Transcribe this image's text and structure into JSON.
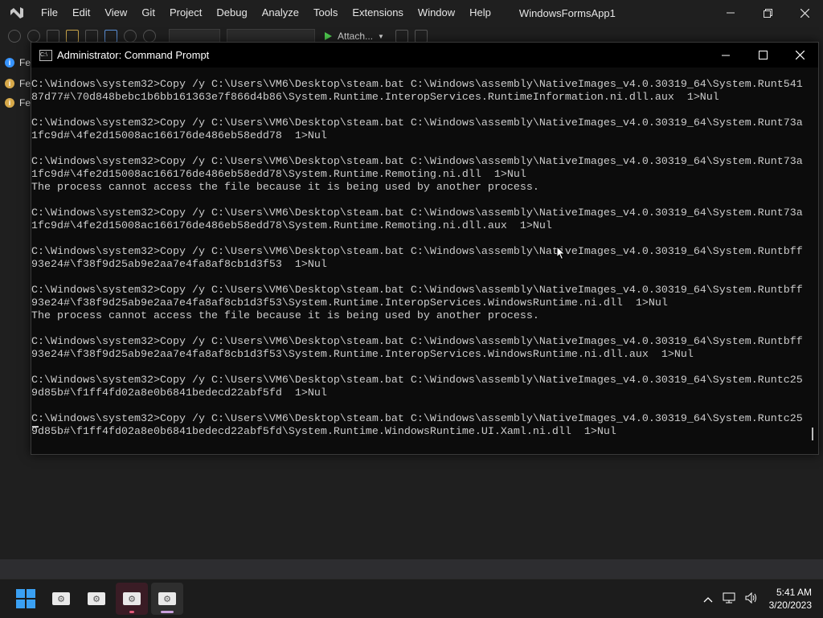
{
  "vs": {
    "menu": [
      "File",
      "Edit",
      "View",
      "Git",
      "Project",
      "Debug",
      "Analyze",
      "Tools",
      "Extensions",
      "Window",
      "Help"
    ],
    "solution_name": "WindowsFormsApp1",
    "attach_label": "Attach...",
    "side_items": [
      "Fe",
      "Fe",
      "Fe"
    ]
  },
  "cmd": {
    "title": "Administrator: Command Prompt",
    "lines": [
      "C:\\Windows\\system32>Copy /y C:\\Users\\VM6\\Desktop\\steam.bat C:\\Windows\\assembly\\NativeImages_v4.0.30319_64\\System.Runt541",
      "87d77#\\70d848bebc1b6bb161363e7f866d4b86\\System.Runtime.InteropServices.RuntimeInformation.ni.dll.aux  1>Nul",
      "",
      "C:\\Windows\\system32>Copy /y C:\\Users\\VM6\\Desktop\\steam.bat C:\\Windows\\assembly\\NativeImages_v4.0.30319_64\\System.Runt73a",
      "1fc9d#\\4fe2d15008ac166176de486eb58edd78  1>Nul",
      "",
      "C:\\Windows\\system32>Copy /y C:\\Users\\VM6\\Desktop\\steam.bat C:\\Windows\\assembly\\NativeImages_v4.0.30319_64\\System.Runt73a",
      "1fc9d#\\4fe2d15008ac166176de486eb58edd78\\System.Runtime.Remoting.ni.dll  1>Nul",
      "The process cannot access the file because it is being used by another process.",
      "",
      "C:\\Windows\\system32>Copy /y C:\\Users\\VM6\\Desktop\\steam.bat C:\\Windows\\assembly\\NativeImages_v4.0.30319_64\\System.Runt73a",
      "1fc9d#\\4fe2d15008ac166176de486eb58edd78\\System.Runtime.Remoting.ni.dll.aux  1>Nul",
      "",
      "C:\\Windows\\system32>Copy /y C:\\Users\\VM6\\Desktop\\steam.bat C:\\Windows\\assembly\\NativeImages_v4.0.30319_64\\System.Runtbff",
      "93e24#\\f38f9d25ab9e2aa7e4fa8af8cb1d3f53  1>Nul",
      "",
      "C:\\Windows\\system32>Copy /y C:\\Users\\VM6\\Desktop\\steam.bat C:\\Windows\\assembly\\NativeImages_v4.0.30319_64\\System.Runtbff",
      "93e24#\\f38f9d25ab9e2aa7e4fa8af8cb1d3f53\\System.Runtime.InteropServices.WindowsRuntime.ni.dll  1>Nul",
      "The process cannot access the file because it is being used by another process.",
      "",
      "C:\\Windows\\system32>Copy /y C:\\Users\\VM6\\Desktop\\steam.bat C:\\Windows\\assembly\\NativeImages_v4.0.30319_64\\System.Runtbff",
      "93e24#\\f38f9d25ab9e2aa7e4fa8af8cb1d3f53\\System.Runtime.InteropServices.WindowsRuntime.ni.dll.aux  1>Nul",
      "",
      "C:\\Windows\\system32>Copy /y C:\\Users\\VM6\\Desktop\\steam.bat C:\\Windows\\assembly\\NativeImages_v4.0.30319_64\\System.Runtc25",
      "9d85b#\\f1ff4fd02a8e0b6841bedecd22abf5fd  1>Nul",
      "",
      "C:\\Windows\\system32>Copy /y C:\\Users\\VM6\\Desktop\\steam.bat C:\\Windows\\assembly\\NativeImages_v4.0.30319_64\\System.Runtc25",
      "9d85b#\\f1ff4fd02a8e0b6841bedecd22abf5fd\\System.Runtime.WindowsRuntime.UI.Xaml.ni.dll  1>Nul"
    ]
  },
  "taskbar": {
    "time": "5:41 AM",
    "date": "3/20/2023"
  },
  "colors": {
    "console_bg": "#0c0c0c",
    "console_text": "#cccccc",
    "taskbar_bg": "#1c1c1c",
    "vs_bg": "#1f1f1f",
    "windows_blue": "#3aa0f3"
  }
}
